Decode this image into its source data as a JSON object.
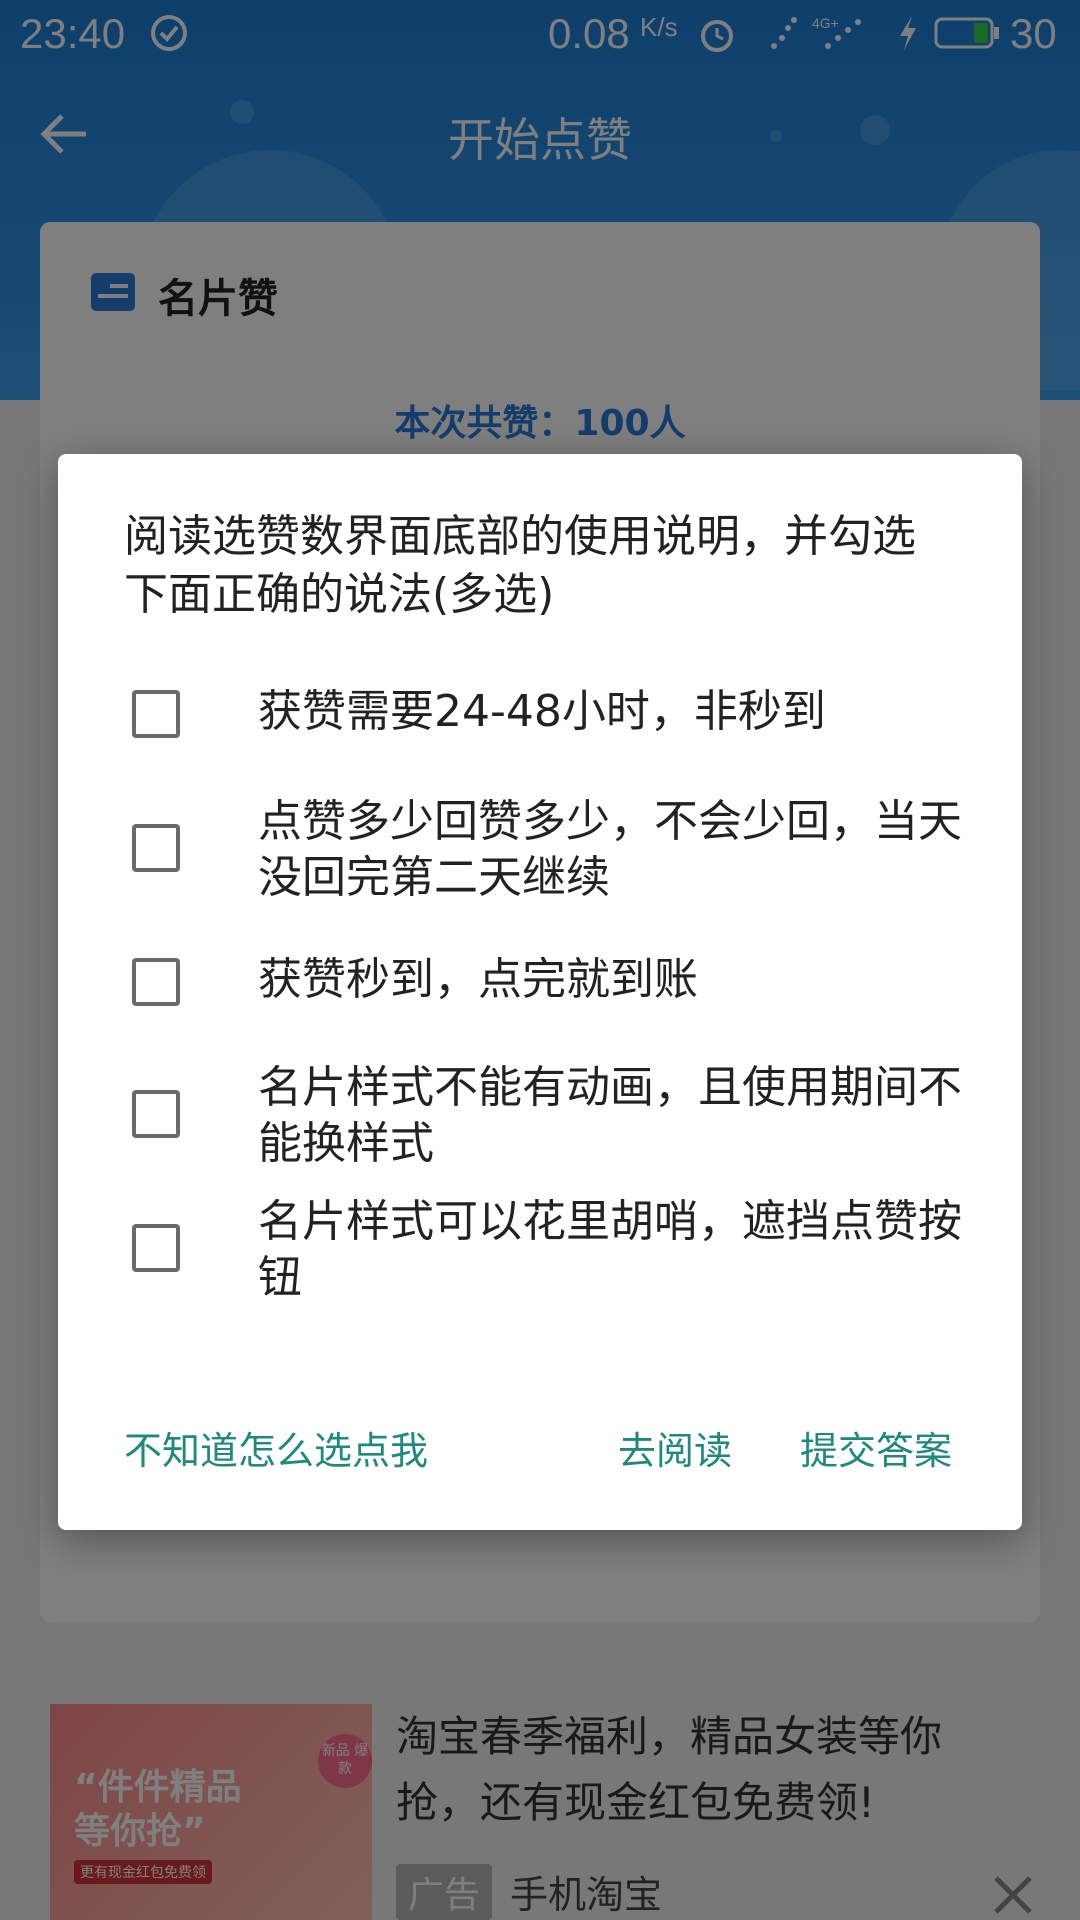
{
  "status_bar": {
    "time": "23:40",
    "net_speed": "0.08",
    "net_speed_unit": "K/s",
    "network_type": "4G+",
    "battery": "30",
    "icons": [
      "check-circle-icon",
      "alarm-icon",
      "signal-icon",
      "charging-icon",
      "battery-icon"
    ]
  },
  "header": {
    "title": "开始点赞",
    "back_icon": "arrow-left-icon"
  },
  "card": {
    "title": "名片赞",
    "icon": "card-icon",
    "total": "本次共赞：100人"
  },
  "dialog": {
    "title": "阅读选赞数界面底部的使用说明，并勾选下面正确的说法(多选)",
    "options": [
      {
        "label": "获赞需要24-48小时，非秒到",
        "checked": false
      },
      {
        "label": "点赞多少回赞多少，不会少回，当天没回完第二天继续",
        "checked": false
      },
      {
        "label": "获赞秒到，点完就到账",
        "checked": false
      },
      {
        "label": "名片样式不能有动画，且使用期间不能换样式",
        "checked": false
      },
      {
        "label": "名片样式可以花里胡哨，遮挡点赞按钮",
        "checked": false
      }
    ],
    "buttons": {
      "help": "不知道怎么选点我",
      "read": "去阅读",
      "submit": "提交答案"
    }
  },
  "ad": {
    "text": "淘宝春季福利，精品女装等你抢，还有现金红包免费领!",
    "label": "广告",
    "source": "手机淘宝",
    "image_headline": "“件件精品 等你抢”",
    "image_sub": "更有现金红包免费领",
    "image_badge": "新品 爆款",
    "close_icon": "close-icon"
  },
  "colors": {
    "header_blue": "#1c7fd8",
    "accent_teal": "#1e8a7c",
    "total_blue": "#2a7bd8"
  }
}
